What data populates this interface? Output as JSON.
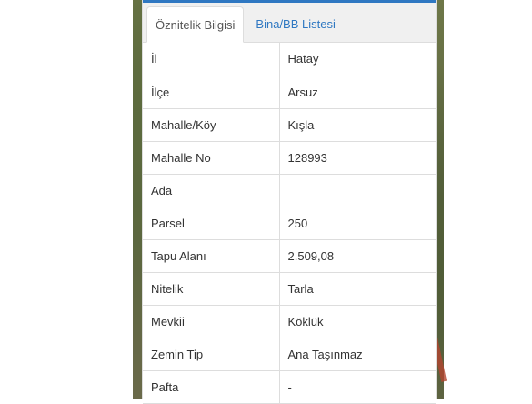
{
  "tabs": [
    {
      "label": "Öznitelik Bilgisi",
      "active": true
    },
    {
      "label": "Bina/BB Listesi",
      "active": false
    }
  ],
  "rows": [
    {
      "key": "İl",
      "value": "Hatay"
    },
    {
      "key": "İlçe",
      "value": "Arsuz"
    },
    {
      "key": "Mahalle/Köy",
      "value": "Kışla"
    },
    {
      "key": "Mahalle No",
      "value": "128993"
    },
    {
      "key": "Ada",
      "value": ""
    },
    {
      "key": "Parsel",
      "value": "250"
    },
    {
      "key": "Tapu Alanı",
      "value": "2.509,08"
    },
    {
      "key": "Nitelik",
      "value": "Tarla"
    },
    {
      "key": "Mevkii",
      "value": "Köklük"
    },
    {
      "key": "Zemin Tip",
      "value": "Ana Taşınmaz"
    },
    {
      "key": "Pafta",
      "value": "-"
    }
  ],
  "colors": {
    "accent": "#2f78c2",
    "border": "#dddddd",
    "text": "#333333"
  }
}
